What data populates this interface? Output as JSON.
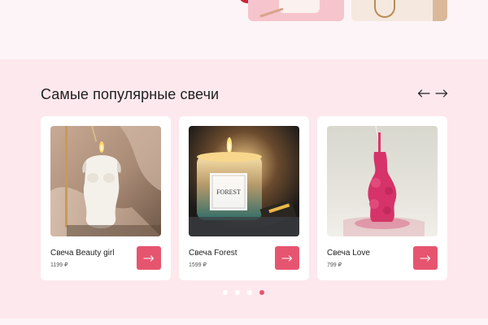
{
  "section": {
    "title": "Самые популярные свечи"
  },
  "products": [
    {
      "name": "Свеча Beauty girl",
      "price": "1199 ₽",
      "image": "white-torso-candle",
      "buy_icon": "arrow-right-icon"
    },
    {
      "name": "Свеча Forest",
      "price": "1599 ₽",
      "image": "forest-jar-candle",
      "label": "FOREST",
      "buy_icon": "arrow-right-icon"
    },
    {
      "name": "Свеча Love",
      "price": "799 ₽",
      "image": "pink-figurine-candle",
      "buy_icon": "arrow-right-icon"
    }
  ],
  "carousel": {
    "prev_icon": "arrow-left-icon",
    "next_icon": "arrow-right-icon",
    "dot_count": 4,
    "active_dot": 4
  },
  "colors": {
    "accent": "#e6556f",
    "section_bg": "#fde8ed",
    "card_bg": "#ffffff"
  }
}
